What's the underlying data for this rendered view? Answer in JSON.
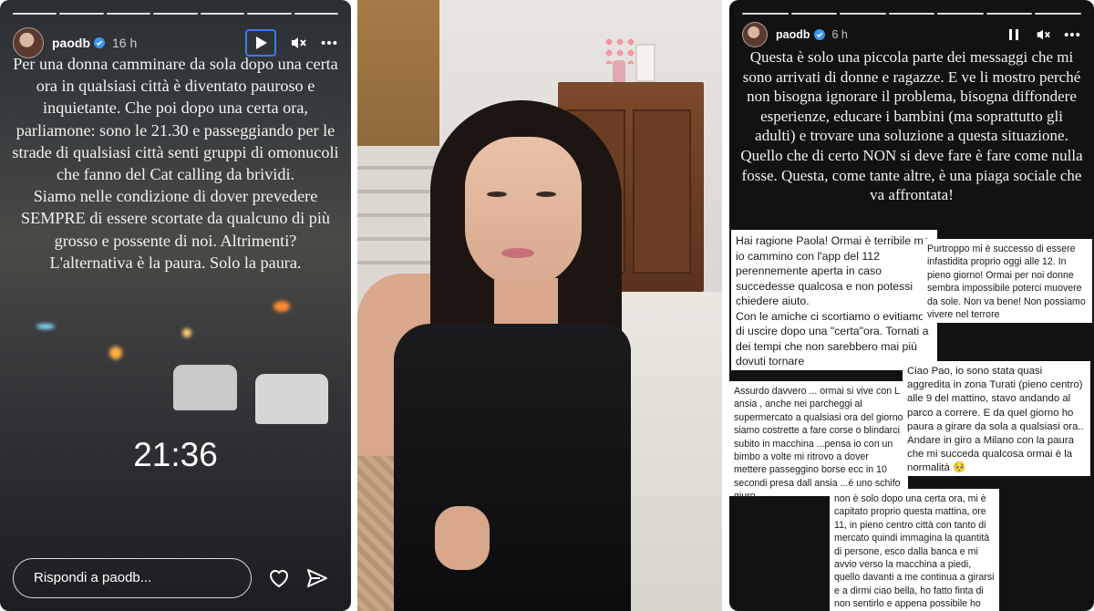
{
  "left_story": {
    "username": "paodb",
    "time_ago": "16 h",
    "segments": 7,
    "text": "Per una donna camminare da sola dopo una certa ora in qualsiasi città è diventato pauroso e inquietante. Che poi dopo una certa ora, parliamone: sono le 21.30 e passeggiando per le strade di qualsiasi città senti gruppi di omonucoli che fanno del Cat calling da brividi.\nSiamo nelle condizione di dover prevedere SEMPRE di essere scortate da qualcuno di più grosso e possente di noi. Altrimenti? L'alternativa è la paura. Solo la paura.",
    "clock": "21:36",
    "reply_placeholder": "Rispondi a paodb...",
    "icons": {
      "play": "play-icon",
      "mute": "mute-icon",
      "more": "more-icon",
      "like": "heart-icon",
      "send": "send-icon",
      "verified": "verified-icon"
    }
  },
  "right_story": {
    "username": "paodb",
    "time_ago": "6 h",
    "segments": 7,
    "text": "Questa è solo una piccola parte dei messaggi che mi sono arrivati di donne e ragazze. E ve li mostro perché non bisogna ignorare il problema, bisogna diffondere esperienze, educare i bambini (ma soprattutto gli adulti) e trovare una soluzione a questa situazione. Quello che di certo NON si deve fare è fare come nulla fosse. Questa, come tante altre, è una piaga sociale che va affrontata!",
    "messages": [
      {
        "text": "Hai ragione Paola! Ormai è terribile ma io cammino con l'app del 112 perennemente aperta in caso succedesse qualcosa e non potessi chiedere aiuto.\nCon le amiche ci scortiamo o evitiamo di uscire dopo una \"certa\"ora. Tornati a dei tempi che non sarebbero mai più dovuti tornare"
      },
      {
        "text": "Purtroppo mi è successo di essere infastidita proprio oggi alle 12. In pieno giorno! Ormai per noi donne sembra impossibile poterci muovere da sole. Non va bene! Non possiamo vivere nel terrore"
      },
      {
        "text": "Assurdo davvero ... ormai si vive con L ansia , anche nei parcheggi al supermercato a qualsiasi ora del giorno siamo costrette a fare corse o blindarci subito in macchina ...pensa io con un bimbo a volte mi ritrovo a dover mettere passeggino borse ecc in 10 secondi presa dall ansia ...é uno schifo giuro"
      },
      {
        "text": "Ciao Pao, io sono stata quasi aggredita in zona Turati (pieno centro) alle 9 del mattino, stavo andando al parco a correre. E da quel giorno ho paura a girare da sola a qualsiasi ora.. Andare in giro a Milano con la paura che mi succeda qualcosa ormai è la normalità 🥺"
      },
      {
        "text": "non è solo dopo una certa ora, mi è capitato proprio questa mattina, ore 11, in pieno centro città con tanto di mercato quindi immagina la quantità di persone, esco dalla banca e mi avvio verso la macchina a piedi, quello davanti a me continua a girarsi e a dirmi ciao bella, ho fatto finta di non sentirlo e appena possibile ho attraversato la strada, però la paura c'è"
      }
    ],
    "icons": {
      "pause": "pause-icon",
      "mute": "mute-icon",
      "more": "more-icon",
      "verified": "verified-icon"
    }
  },
  "colors": {
    "accent_focus": "#3c7bf0",
    "verified_blue": "#3897f0"
  }
}
